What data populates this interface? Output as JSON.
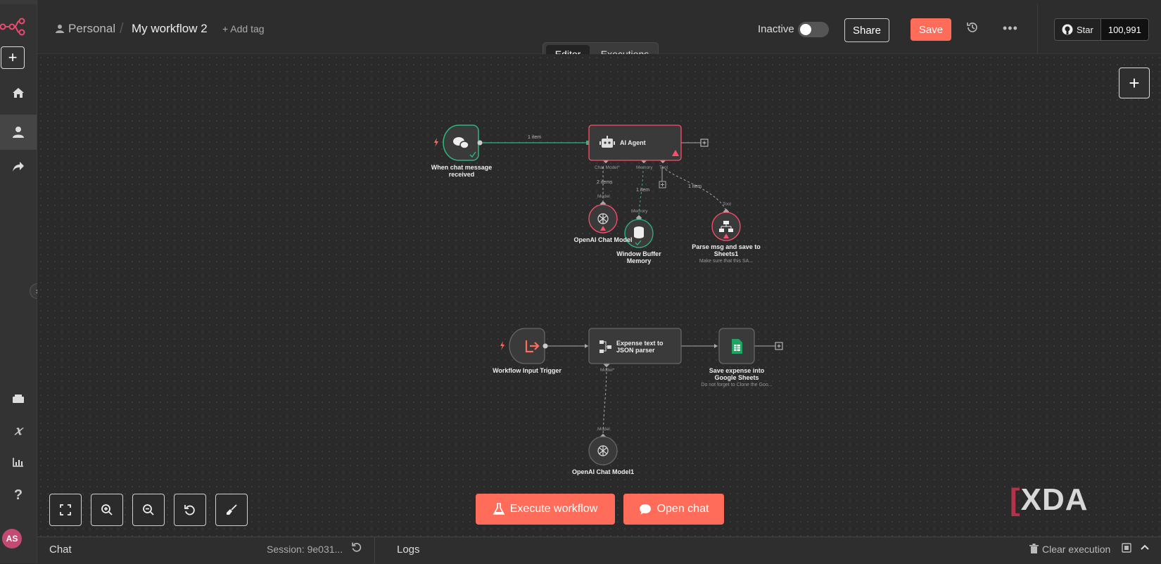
{
  "header": {
    "workspace": "Personal",
    "workflow_title": "My workflow 2",
    "add_tag": "+ Add tag",
    "status_label": "Inactive",
    "share": "Share",
    "save": "Save",
    "github_star": "Star",
    "github_count": "100,991"
  },
  "tabs": {
    "editor": "Editor",
    "executions": "Executions"
  },
  "nodes": {
    "chat_trigger": "When chat message received",
    "ai_agent": "AI Agent",
    "openai_model": "OpenAI Chat Model",
    "window_memory": "Window Buffer Memory",
    "parse_tool": "Parse msg and save to Sheets1",
    "parse_tool_note": "Make sure that this SA...",
    "workflow_trigger": "Workflow Input Trigger",
    "expense_parser": "Expense text to JSON parser",
    "save_sheets": "Save expense into Google Sheets",
    "save_sheets_note": "Do not forget to Clone the Goo...",
    "openai_model1": "OpenAI Chat Model1"
  },
  "ports": {
    "chat_model": "Chat Model*",
    "memory": "Memory",
    "tool": "Tool",
    "model": "Model",
    "memory_in": "Memory",
    "tool_in": "Tool",
    "model_star": "Model*",
    "model_in": "Model"
  },
  "edges": {
    "e1": "1 item",
    "e2": "2 items",
    "e3": "1 item",
    "e4": "1 item"
  },
  "actions": {
    "execute": "Execute workflow",
    "open_chat": "Open chat"
  },
  "bottom": {
    "chat": "Chat",
    "session": "Session: 9e031...",
    "logs": "Logs",
    "clear": "Clear execution"
  },
  "user": {
    "initials": "AS"
  },
  "watermark": "XDA",
  "colors": {
    "accent": "#ff6d5a",
    "success": "#2fb67f",
    "error": "#ff4d6d",
    "canvas": "#2a2a2a"
  }
}
